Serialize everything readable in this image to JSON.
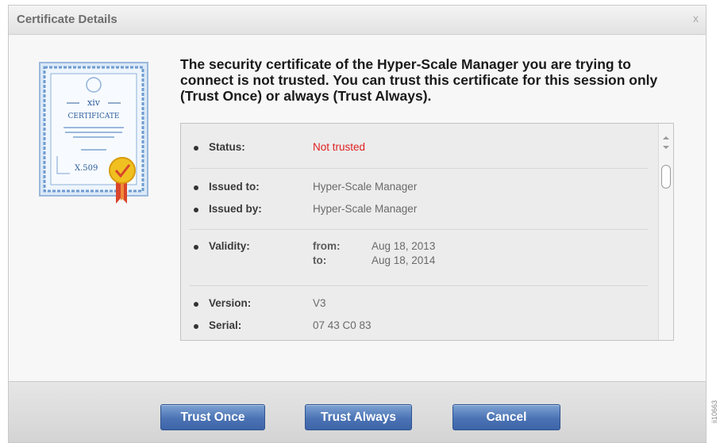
{
  "dialog": {
    "title": "Certificate Details",
    "close_glyph": "x"
  },
  "certificate_icon": {
    "brand": "xiv",
    "heading": "CERTIFICATE",
    "standard": "X.509"
  },
  "message": "The security certificate of the Hyper-Scale Manager you are trying to connect is not trusted. You can trust this certificate for this session only (Trust Once) or always (Trust Always).",
  "details": {
    "status": {
      "label": "Status:",
      "value": "Not trusted"
    },
    "issued_to": {
      "label": "Issued to:",
      "value": "Hyper-Scale Manager"
    },
    "issued_by": {
      "label": "Issued by:",
      "value": "Hyper-Scale Manager"
    },
    "validity": {
      "label": "Validity:",
      "from_label": "from:",
      "from_value": "Aug 18, 2013",
      "to_label": "to:",
      "to_value": "Aug 18, 2014"
    },
    "version": {
      "label": "Version:",
      "value": "V3"
    },
    "serial": {
      "label": "Serial:",
      "value": "07 43 C0 83"
    }
  },
  "buttons": {
    "trust_once": "Trust Once",
    "trust_always": "Trust Always",
    "cancel": "Cancel"
  },
  "side_text": "ii10663",
  "colors": {
    "status_red": "#e02020",
    "button_blue": "#4b73b4"
  }
}
